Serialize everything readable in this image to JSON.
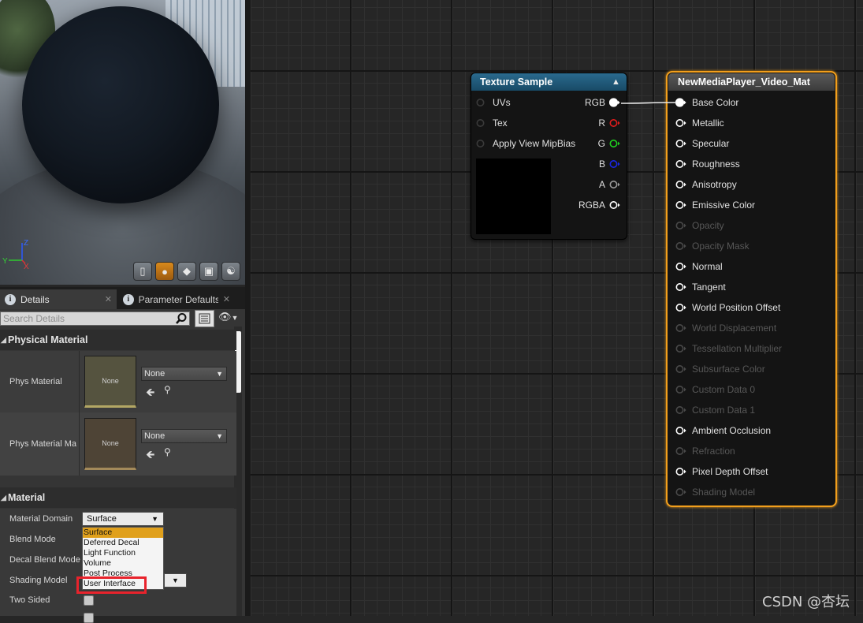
{
  "viewport": {
    "axis_labels": {
      "x": "X",
      "y": "Y",
      "z": "Z"
    },
    "toolbar_buttons": [
      "cylinder-icon",
      "sphere-icon",
      "plane-icon",
      "cube-icon",
      "teapot-icon"
    ],
    "active_button": "sphere-icon"
  },
  "details_panel": {
    "tabs": [
      {
        "label": "Details",
        "icon": "info-icon"
      },
      {
        "label": "Parameter Defaults",
        "icon": "info-icon"
      }
    ],
    "search_placeholder": "Search Details",
    "sections": {
      "physical_material": {
        "title": "Physical Material",
        "rows": [
          {
            "label": "Phys Material",
            "thumb_text": "None",
            "combo_value": "None"
          },
          {
            "label": "Phys Material Ma",
            "thumb_text": "None",
            "combo_value": "None"
          }
        ]
      },
      "material": {
        "title": "Material",
        "rows": [
          {
            "label": "Material Domain"
          },
          {
            "label": "Blend Mode"
          },
          {
            "label": "Decal Blend Mode"
          },
          {
            "label": "Shading Model"
          },
          {
            "label": "Two Sided"
          }
        ],
        "material_domain_value": "Surface",
        "domain_options": [
          "Surface",
          "Deferred Decal",
          "Light Function",
          "Volume",
          "Post Process",
          "User Interface"
        ],
        "domain_selected_index": 0,
        "highlighted_option": "User Interface"
      }
    }
  },
  "graph": {
    "texture_node": {
      "title": "Texture Sample",
      "inputs": [
        "UVs",
        "Tex",
        "Apply View MipBias"
      ],
      "outputs": [
        {
          "label": "RGB",
          "color": "#ffffff",
          "connected": true
        },
        {
          "label": "R",
          "color": "#e11c1c",
          "connected": false
        },
        {
          "label": "G",
          "color": "#1fd11f",
          "connected": false
        },
        {
          "label": "B",
          "color": "#1a27e6",
          "connected": false
        },
        {
          "label": "A",
          "color": "#9b9b9b",
          "connected": false
        },
        {
          "label": "RGBA",
          "color": "#ffffff",
          "connected": false
        }
      ]
    },
    "material_node": {
      "title": "NewMediaPlayer_Video_Mat",
      "accent_color": "#f29f1c",
      "pins": [
        {
          "label": "Base Color",
          "enabled": true,
          "connected": true
        },
        {
          "label": "Metallic",
          "enabled": true
        },
        {
          "label": "Specular",
          "enabled": true
        },
        {
          "label": "Roughness",
          "enabled": true
        },
        {
          "label": "Anisotropy",
          "enabled": true
        },
        {
          "label": "Emissive Color",
          "enabled": true
        },
        {
          "label": "Opacity",
          "enabled": false
        },
        {
          "label": "Opacity Mask",
          "enabled": false
        },
        {
          "label": "Normal",
          "enabled": true
        },
        {
          "label": "Tangent",
          "enabled": true
        },
        {
          "label": "World Position Offset",
          "enabled": true
        },
        {
          "label": "World Displacement",
          "enabled": false
        },
        {
          "label": "Tessellation Multiplier",
          "enabled": false
        },
        {
          "label": "Subsurface Color",
          "enabled": false
        },
        {
          "label": "Custom Data 0",
          "enabled": false
        },
        {
          "label": "Custom Data 1",
          "enabled": false
        },
        {
          "label": "Ambient Occlusion",
          "enabled": true
        },
        {
          "label": "Refraction",
          "enabled": false
        },
        {
          "label": "Pixel Depth Offset",
          "enabled": true
        },
        {
          "label": "Shading Model",
          "enabled": false
        }
      ]
    }
  },
  "watermark": "CSDN @杏坛"
}
